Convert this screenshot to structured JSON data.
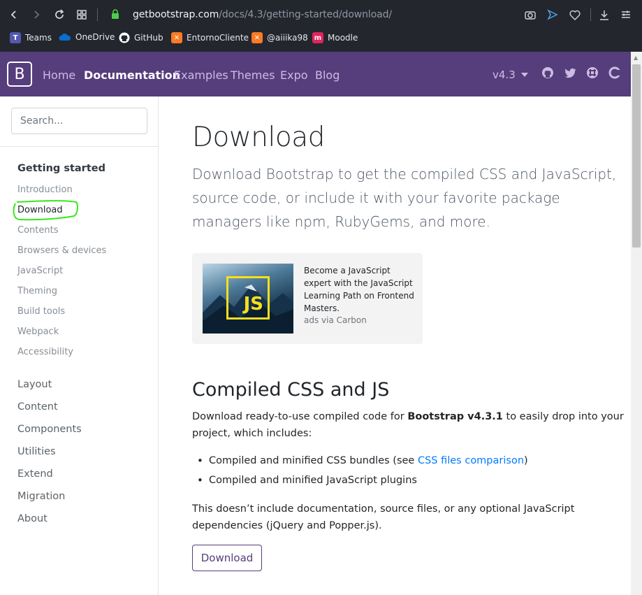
{
  "browser": {
    "url_host": "getbootstrap.com",
    "url_path": "/docs/4.3/getting-started/download/",
    "bookmarks": [
      {
        "label": "Teams",
        "icon": "teams-icon",
        "color": "#5558af"
      },
      {
        "label": "OneDrive",
        "icon": "onedrive-icon",
        "color": "#0a6ed1"
      },
      {
        "label": "GitHub",
        "icon": "github-icon",
        "color": "#ffffff"
      },
      {
        "label": "EntornoCliente",
        "icon": "xampp-icon",
        "color": "#fb7a24"
      },
      {
        "label": "@aiiika98",
        "icon": "xampp-icon",
        "color": "#fb7a24"
      },
      {
        "label": "Moodle",
        "icon": "moodle-icon",
        "color": "#f98012"
      }
    ]
  },
  "navbar": {
    "brand": "B",
    "links": [
      "Home",
      "Documentation",
      "Examples",
      "Themes",
      "Expo",
      "Blog"
    ],
    "active": "Documentation",
    "version": "v4.3",
    "color": "#563d7c"
  },
  "sidebar": {
    "search_placeholder": "Search...",
    "section_title": "Getting started",
    "section_links": [
      "Introduction",
      "Download",
      "Contents",
      "Browsers & devices",
      "JavaScript",
      "Theming",
      "Build tools",
      "Webpack",
      "Accessibility"
    ],
    "active_link": "Download",
    "categories": [
      "Layout",
      "Content",
      "Components",
      "Utilities",
      "Extend",
      "Migration",
      "About"
    ]
  },
  "main": {
    "title": "Download",
    "lead": "Download Bootstrap to get the compiled CSS and JavaScript, source code, or include it with your favorite package managers like npm, RubyGems, and more.",
    "ad": {
      "image_text": "JS",
      "text": "Become a JavaScript expert with the JavaScript Learning Path on Frontend Masters.",
      "via": "ads via Carbon"
    },
    "section_title": "Compiled CSS and JS",
    "para1_before": "Download ready-to-use compiled code for ",
    "para1_bold": "Bootstrap v4.3.1",
    "para1_after": " to easily drop into your project, which includes:",
    "bullet1_before": "Compiled and minified CSS bundles (see ",
    "bullet1_link": "CSS files comparison",
    "bullet1_after": ")",
    "bullet2": "Compiled and minified JavaScript plugins",
    "para2": "This doesn’t include documentation, source files, or any optional JavaScript dependencies (jQuery and Popper.js).",
    "download_button": "Download"
  }
}
